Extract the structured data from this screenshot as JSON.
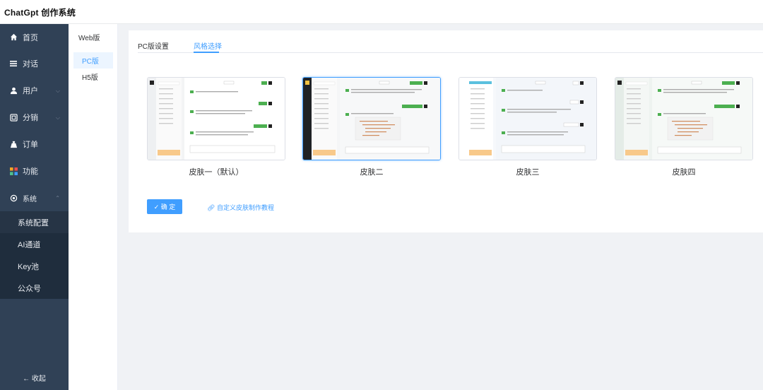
{
  "app": {
    "title": "ChatGpt 创作系统"
  },
  "sidebar": {
    "items": [
      {
        "label": "首页",
        "icon": "home-icon"
      },
      {
        "label": "对话",
        "icon": "list-icon"
      },
      {
        "label": "用户",
        "icon": "user-icon"
      },
      {
        "label": "分销",
        "icon": "share-icon"
      },
      {
        "label": "订单",
        "icon": "order-icon"
      },
      {
        "label": "功能",
        "icon": "grid-icon"
      },
      {
        "label": "系统",
        "icon": "settings-icon"
      }
    ],
    "system_sub": [
      {
        "label": "系统配置"
      },
      {
        "label": "AI通道"
      },
      {
        "label": "Key池"
      },
      {
        "label": "公众号"
      }
    ],
    "collapse_label": "← 收起"
  },
  "subnav": {
    "group": "Web版",
    "items": [
      {
        "label": "PC版"
      },
      {
        "label": "H5版"
      }
    ]
  },
  "tabs": [
    {
      "label": "PC版设置"
    },
    {
      "label": "风格选择"
    }
  ],
  "skins": [
    {
      "label": "皮肤一（默认）"
    },
    {
      "label": "皮肤二"
    },
    {
      "label": "皮肤三"
    },
    {
      "label": "皮肤四"
    }
  ],
  "actions": {
    "confirm_label": "✓ 确 定",
    "tutorial_label": "自定义皮肤制作教程"
  },
  "colors": {
    "accent": "#409eff",
    "sidebar": "#304156",
    "sidebar_sub": "#1f2d3d"
  }
}
